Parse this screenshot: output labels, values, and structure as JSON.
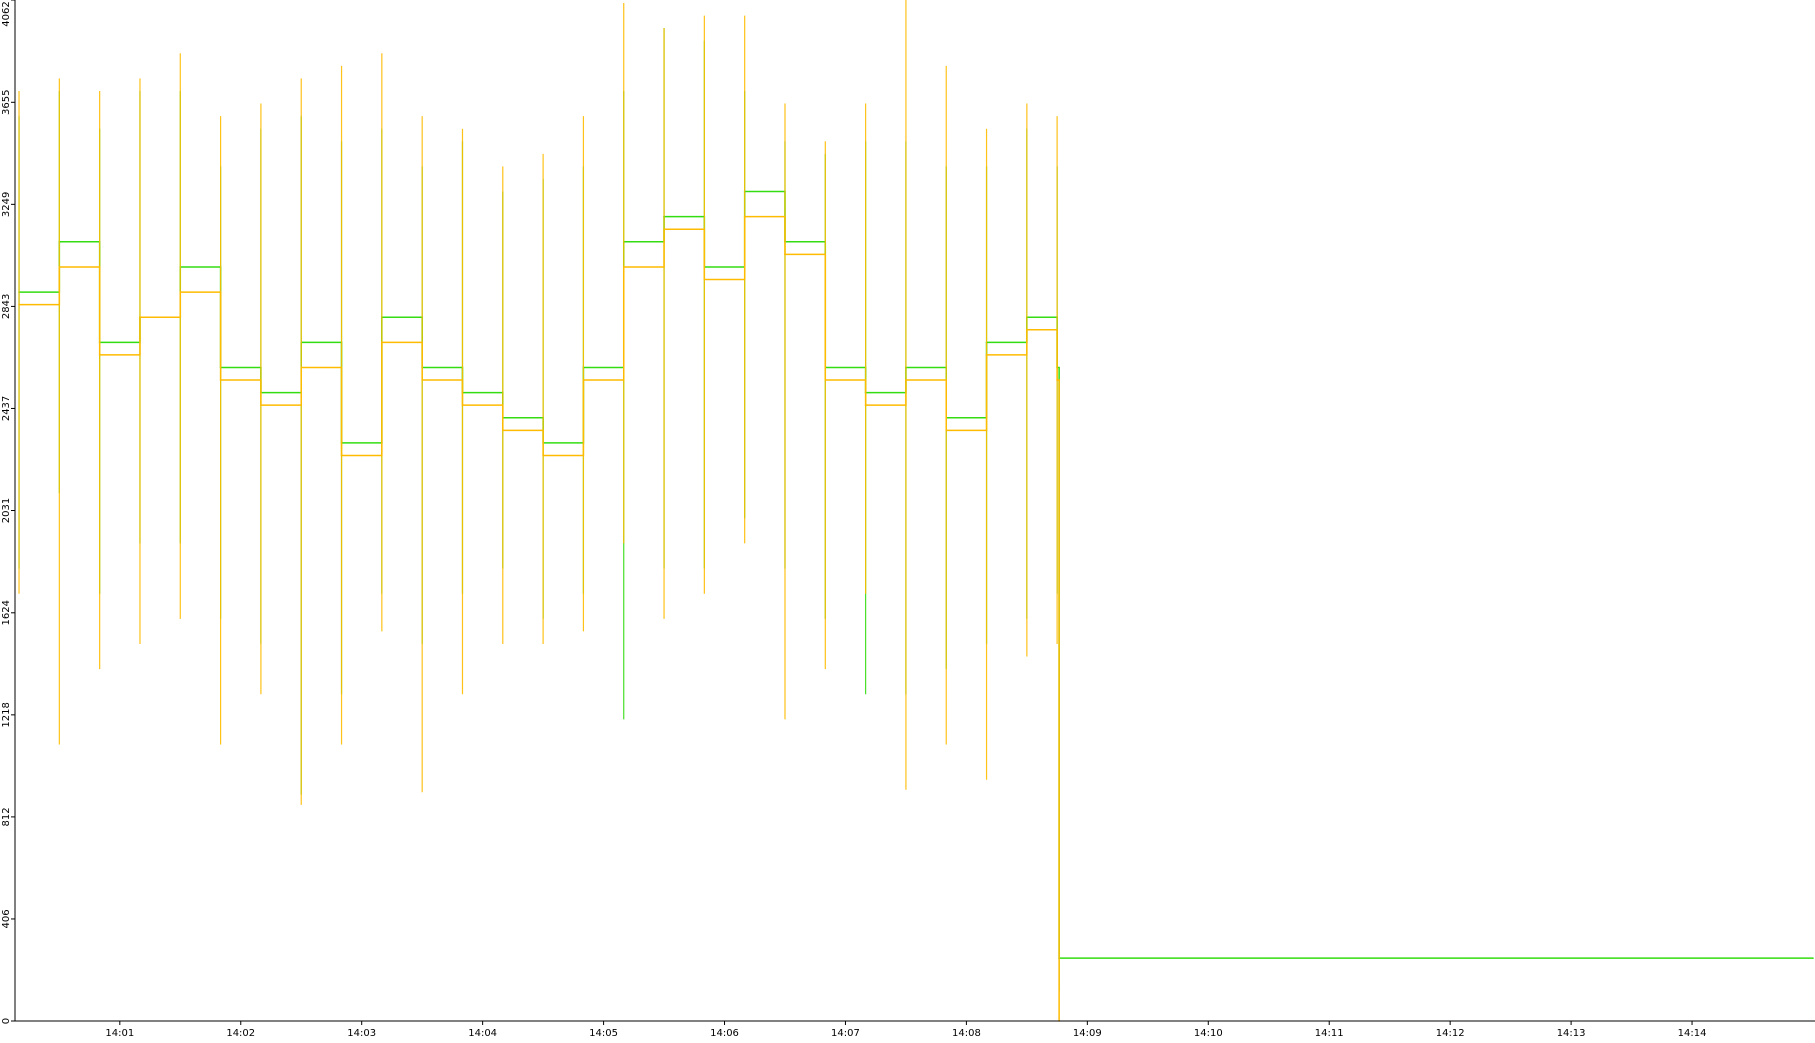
{
  "chart_data": {
    "type": "line",
    "title": "",
    "xlabel": "",
    "ylabel": "",
    "x_ticks": [
      "14:01",
      "14:02",
      "14:03",
      "14:04",
      "14:05",
      "14:06",
      "14:07",
      "14:08",
      "14:09",
      "14:10",
      "14:11",
      "14:12",
      "14:13",
      "14:14"
    ],
    "y_ticks": [
      "0",
      "406",
      "812",
      "1218",
      "1624",
      "2031",
      "2437",
      "2843",
      "3249",
      "3655",
      "4062"
    ],
    "xlim": [
      "14:00:08",
      "14:15:01"
    ],
    "ylim": [
      0,
      4062
    ],
    "grid": false,
    "legend": "none",
    "series": [
      {
        "color": "#33dd11",
        "x": [
          "14:00:10",
          "14:00:30",
          "14:00:50",
          "14:01:10",
          "14:01:30",
          "14:01:50",
          "14:02:10",
          "14:02:30",
          "14:02:50",
          "14:03:10",
          "14:03:30",
          "14:03:50",
          "14:04:10",
          "14:04:30",
          "14:04:50",
          "14:05:10",
          "14:05:30",
          "14:05:50",
          "14:06:10",
          "14:06:30",
          "14:06:50",
          "14:07:10",
          "14:07:30",
          "14:07:50",
          "14:08:10",
          "14:08:30",
          "14:08:45",
          "14:08:46",
          "14:15:00"
        ],
        "y": [
          2900,
          3100,
          2700,
          2800,
          3000,
          2600,
          2500,
          2700,
          2300,
          2800,
          2600,
          2500,
          2400,
          2300,
          2600,
          3100,
          3200,
          3000,
          3300,
          3100,
          2600,
          2500,
          2600,
          2400,
          2700,
          2800,
          2600,
          250,
          250
        ],
        "min": [
          1800,
          2100,
          1700,
          1900,
          1900,
          1600,
          1500,
          900,
          1300,
          1700,
          1500,
          1700,
          1800,
          1600,
          1700,
          1200,
          1800,
          1800,
          2000,
          1800,
          1600,
          1300,
          1300,
          1400,
          1500,
          1600,
          1700,
          120,
          250
        ],
        "max": [
          3600,
          3700,
          3550,
          3700,
          3700,
          3400,
          3550,
          3600,
          3500,
          3550,
          3400,
          3500,
          3300,
          3350,
          3400,
          3700,
          3950,
          3900,
          3700,
          3500,
          3450,
          3500,
          3500,
          3400,
          3400,
          3550,
          3400,
          250,
          250
        ]
      },
      {
        "color": "#ffbb00",
        "x": [
          "14:00:10",
          "14:00:30",
          "14:00:50",
          "14:01:10",
          "14:01:30",
          "14:01:50",
          "14:02:10",
          "14:02:30",
          "14:02:50",
          "14:03:10",
          "14:03:30",
          "14:03:50",
          "14:04:10",
          "14:04:30",
          "14:04:50",
          "14:05:10",
          "14:05:30",
          "14:05:50",
          "14:06:10",
          "14:06:30",
          "14:06:50",
          "14:07:10",
          "14:07:30",
          "14:07:50",
          "14:08:10",
          "14:08:30",
          "14:08:45",
          "14:08:46"
        ],
        "y": [
          2850,
          3000,
          2650,
          2800,
          2900,
          2550,
          2450,
          2600,
          2250,
          2700,
          2550,
          2450,
          2350,
          2250,
          2550,
          3000,
          3150,
          2950,
          3200,
          3050,
          2550,
          2450,
          2550,
          2350,
          2650,
          2750,
          2550,
          0
        ],
        "min": [
          1700,
          1100,
          1400,
          1500,
          1600,
          1100,
          1300,
          860,
          1100,
          1550,
          910,
          1300,
          1500,
          1500,
          1550,
          1900,
          1600,
          1700,
          1900,
          1200,
          1400,
          1700,
          920,
          1100,
          960,
          1450,
          1500,
          0
        ],
        "max": [
          3700,
          3750,
          3700,
          3750,
          3850,
          3600,
          3650,
          3750,
          3800,
          3850,
          3600,
          3550,
          3400,
          3450,
          3600,
          4050,
          3950,
          4000,
          4000,
          3650,
          3500,
          3650,
          4062,
          3800,
          3550,
          3650,
          3600,
          0
        ]
      }
    ]
  }
}
